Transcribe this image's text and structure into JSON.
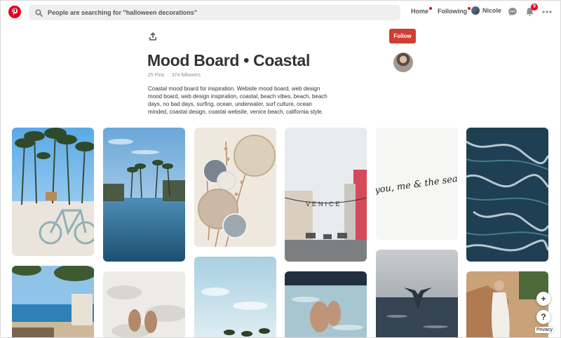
{
  "header": {
    "search_placeholder": "People are searching for \"halloween decorations\"",
    "nav_home": "Home",
    "nav_following": "Following",
    "user_name": "Nicole",
    "notifications_count": "9"
  },
  "board": {
    "follow_label": "Follow",
    "title": "Mood Board • Coastal",
    "pins_count": "25 Pins",
    "separator": "·",
    "followers_count": "374 followers",
    "description": "Coastal mood board for inspiration. Website mood board, web design mood board, web design inspiration, coastal, beach vibes, beach, beach days, no bad days, surfing, ocean, underwater, surf culture, ocean minded, coastal design, coastal website, venice beach, california style."
  },
  "pins": {
    "pin_4_sign": "VENICE",
    "pin_5_text": "you, me & the sea"
  },
  "floating": {
    "add_label": "+",
    "help_label": "?",
    "privacy_label": "Privacy"
  },
  "colors": {
    "brand_red": "#e60023",
    "follow_red": "#d13e33"
  }
}
